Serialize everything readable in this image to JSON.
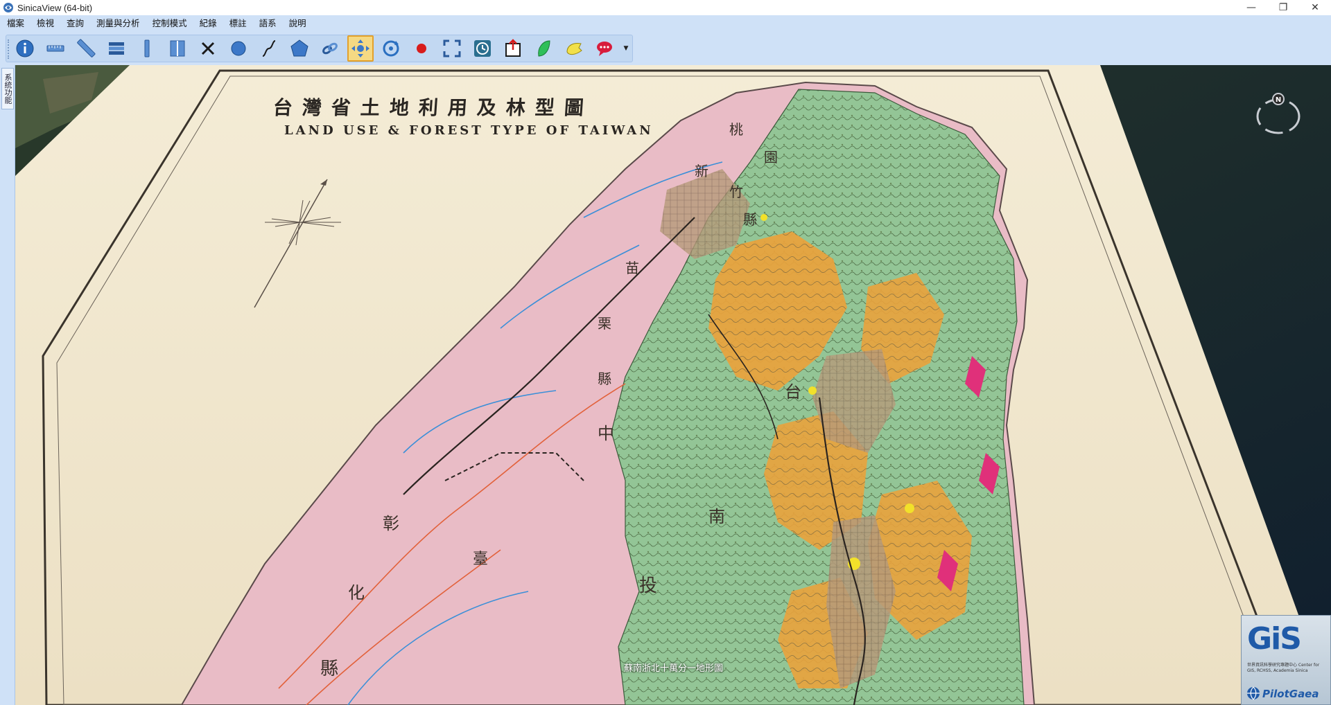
{
  "window": {
    "title": "SinicaView (64-bit)",
    "controls": {
      "minimize": "—",
      "restore": "❐",
      "close": "✕"
    }
  },
  "menu": [
    "檔案",
    "檢視",
    "查詢",
    "測量與分析",
    "控制模式",
    "紀錄",
    "標註",
    "語系",
    "說明"
  ],
  "toolbar": {
    "buttons": [
      {
        "icon": "info-icon"
      },
      {
        "icon": "measure-line-icon"
      },
      {
        "icon": "ruler-icon"
      },
      {
        "icon": "layers-icon"
      },
      {
        "icon": "vertical-measure-icon"
      },
      {
        "icon": "book-icon"
      },
      {
        "icon": "clear-icon"
      },
      {
        "icon": "circle-icon"
      },
      {
        "icon": "path-icon"
      },
      {
        "icon": "polygon-icon"
      },
      {
        "icon": "link-icon"
      },
      {
        "icon": "pan-icon",
        "active": true
      },
      {
        "icon": "rotate-icon"
      },
      {
        "icon": "record-icon"
      },
      {
        "icon": "fullscreen-icon"
      },
      {
        "icon": "history-icon"
      },
      {
        "icon": "export-icon"
      },
      {
        "icon": "leaf-icon"
      },
      {
        "icon": "bookmark-icon"
      },
      {
        "icon": "comment-icon"
      }
    ]
  },
  "left_dock": {
    "tab_label": "系統功能"
  },
  "map": {
    "title_zh": "台灣省土地利用及林型圖",
    "title_en": "LAND USE & FOREST TYPE OF TAIWAN",
    "layer_caption": "蘇南浙北十萬分一地形圖",
    "compass_label": "N",
    "county_labels": [
      "桃",
      "園",
      "新",
      "竹",
      "縣",
      "苗",
      "栗",
      "縣",
      "中",
      "台",
      "南",
      "投",
      "彰",
      "化",
      "縣",
      "臺"
    ]
  },
  "logo": {
    "brand": "GiS",
    "subtitle": "世界資訊科學研究專題中心 Center for GIS, RCHSS, Academia Sinica",
    "partner": "PilotGaea"
  },
  "colors": {
    "menubar_bg": "#cfe1f7",
    "toolbar_active_bg": "#f5d983",
    "paper": "#efe6cf",
    "sea": "#1d2a37",
    "pink_land": "#e8b9c4",
    "forest_green": "#8cc48e",
    "orange_zone": "#f0a53a"
  }
}
